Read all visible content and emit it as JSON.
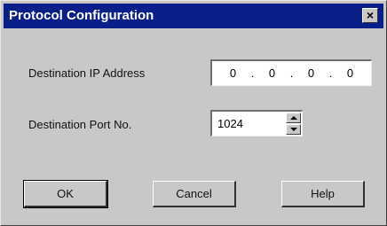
{
  "dialog": {
    "title": "Protocol Configuration",
    "close_glyph": "×",
    "colors": {
      "titlebar": "#0a1f8a",
      "face": "#c8c8c8"
    }
  },
  "destination_ip": {
    "label": "Destination IP Address",
    "octets": [
      "0",
      "0",
      "0",
      "0"
    ],
    "separator": "."
  },
  "destination_port": {
    "label": "Destination Port No.",
    "value": "1024"
  },
  "buttons": {
    "ok": "OK",
    "cancel": "Cancel",
    "help": "Help"
  }
}
